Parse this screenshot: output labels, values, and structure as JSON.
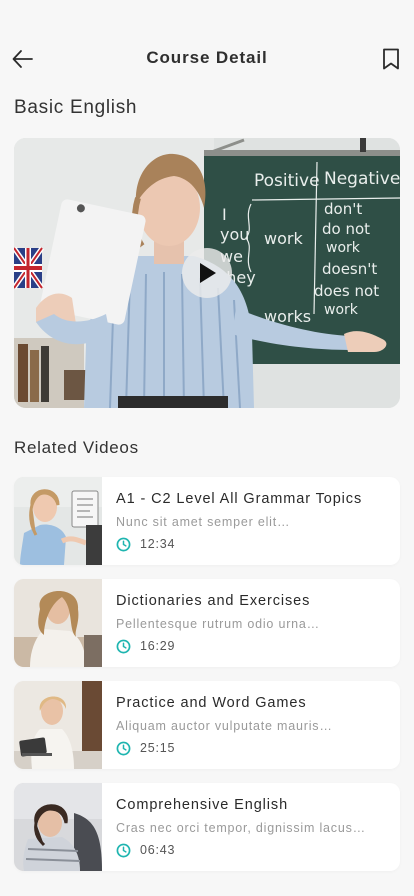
{
  "header": {
    "title": "Course Detail",
    "back_icon": "arrow-left-icon",
    "bookmark_icon": "bookmark-icon"
  },
  "course": {
    "title": "Basic English",
    "video": {
      "play_icon": "play-icon",
      "board_text": {
        "col1": "Positive",
        "col2": "Negative",
        "pronouns": [
          "I",
          "you",
          "we",
          "they"
        ],
        "verbs": [
          "work",
          "works"
        ],
        "negatives": [
          "don't",
          "do not",
          "work",
          "doesn't",
          "does not",
          "work"
        ]
      }
    }
  },
  "related": {
    "title": "Related Videos",
    "items": [
      {
        "title": "A1 - C2 Level All Grammar Topics",
        "description": "Nunc sit amet semper elit…",
        "duration": "12:34"
      },
      {
        "title": "Dictionaries and Exercises",
        "description": "Pellentesque rutrum odio urna…",
        "duration": "16:29"
      },
      {
        "title": "Practice and Word Games",
        "description": "Aliquam auctor vulputate mauris…",
        "duration": "25:15"
      },
      {
        "title": "Comprehensive English",
        "description": "Cras nec orci tempor, dignissim lacus…",
        "duration": "06:43"
      }
    ]
  },
  "colors": {
    "accent": "#1fb5b0",
    "background": "#f7f7f7",
    "card": "#ffffff",
    "chalkboard": "#2f4f46"
  }
}
